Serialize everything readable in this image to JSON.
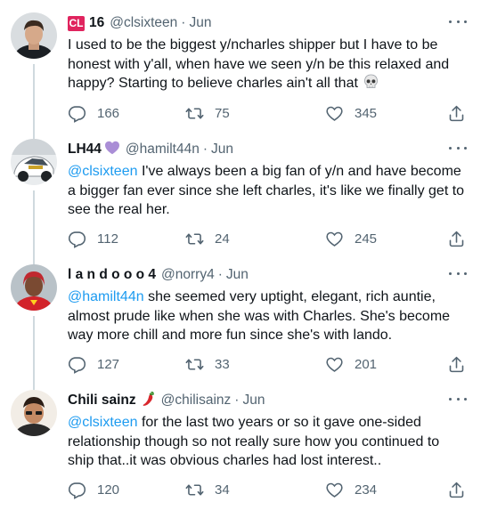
{
  "tweets": [
    {
      "display_name": "16",
      "badge": "CL",
      "handle": "@clsixteen",
      "time": "Jun",
      "mention": "",
      "text": "I used to be the biggest y/ncharles shipper but I have to be honest with y'all, when have we seen y/n be this relaxed and happy? Starting to believe charles ain't all that",
      "text_emoji": "skull",
      "replies": "166",
      "retweets": "75",
      "likes": "345"
    },
    {
      "display_name": "LH44",
      "name_emoji": "purple-heart",
      "handle": "@hamilt44n",
      "time": "Jun",
      "mention": "@clsixteen",
      "text": " I've always been a big fan of y/n and have become a bigger fan ever since she left charles, it's like we finally get to see the real her.",
      "replies": "112",
      "retweets": "24",
      "likes": "245"
    },
    {
      "display_name": "l a n d o o o 4",
      "handle": "@norry4",
      "time": "Jun",
      "mention": "@hamilt44n",
      "text": " she seemed very uptight, elegant, rich auntie, almost prude like when she was with Charles. She's become way more chill and more fun since she's with lando.",
      "replies": "127",
      "retweets": "33",
      "likes": "201"
    },
    {
      "display_name": "Chili sainz",
      "name_emoji": "hot-pepper",
      "handle": "@chilisainz",
      "time": "Jun",
      "mention": "@clsixteen",
      "text": " for the last two years or so it gave one-sided relationship though so not really sure how you continued to ship that..it was obvious charles had lost interest..",
      "replies": "120",
      "retweets": "34",
      "likes": "234"
    }
  ],
  "colors": {
    "text": "#0f1419",
    "secondary": "#536471",
    "link": "#1d9bf0",
    "thread_line": "#cfd9de",
    "badge_red": "#e0245e"
  },
  "separator": "·"
}
